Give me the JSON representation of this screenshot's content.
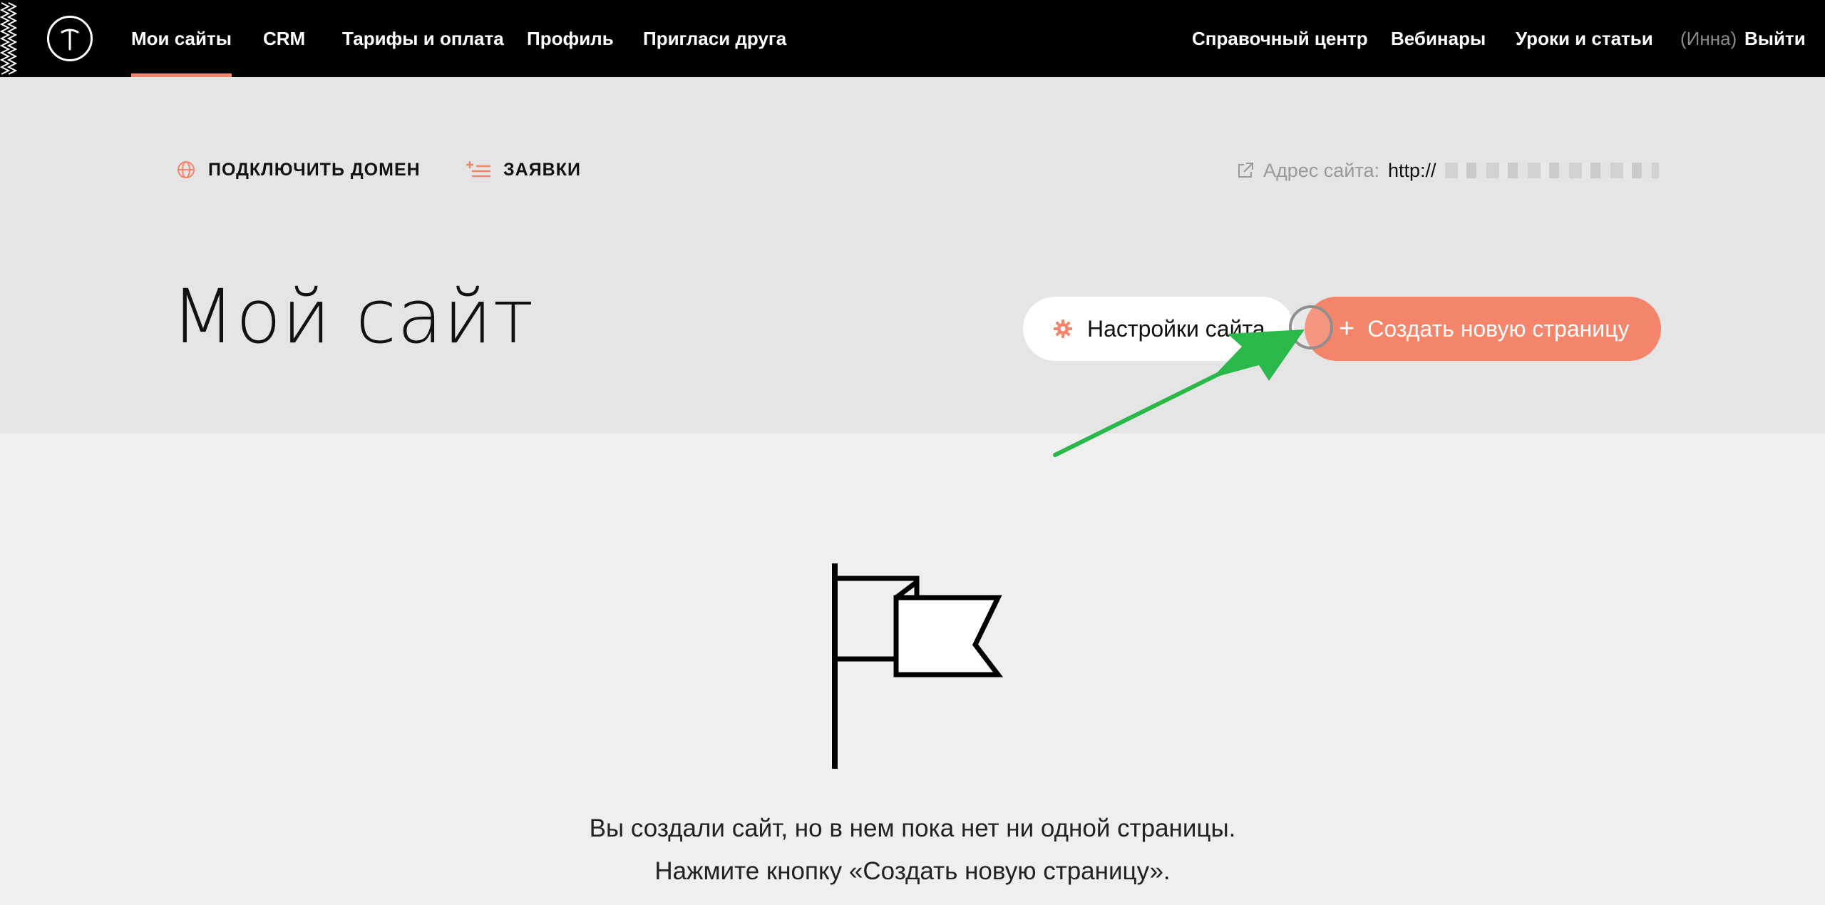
{
  "nav": {
    "left": [
      {
        "label": "Мои сайты",
        "active": true
      },
      {
        "label": "CRM"
      },
      {
        "label": "Тарифы и оплата"
      },
      {
        "label": "Профиль"
      },
      {
        "label": "Пригласи друга"
      }
    ],
    "right": [
      {
        "label": "Справочный центр"
      },
      {
        "label": "Вебинары"
      },
      {
        "label": "Уроки и статьи"
      }
    ],
    "user": "(Инна)",
    "logout": "Выйти"
  },
  "toolbar": {
    "connect_domain": "ПОДКЛЮЧИТЬ ДОМЕН",
    "requests": "ЗАЯВКИ",
    "address_label": "Адрес сайта:",
    "address_value": "http://"
  },
  "page": {
    "title": "Мой сайт",
    "settings_button": "Настройки сайта",
    "create_button": "Создать новую страницу"
  },
  "empty_state": {
    "line1": "Вы создали сайт, но в нем пока нет ни одной страницы.",
    "line2": "Нажмите кнопку «Создать новую страницу»."
  },
  "colors": {
    "accent": "#f4846a",
    "nav_bg": "#000000",
    "header_bg": "#e5e5e5",
    "body_bg": "#efefef",
    "annotation_arrow": "#2ab84a"
  }
}
